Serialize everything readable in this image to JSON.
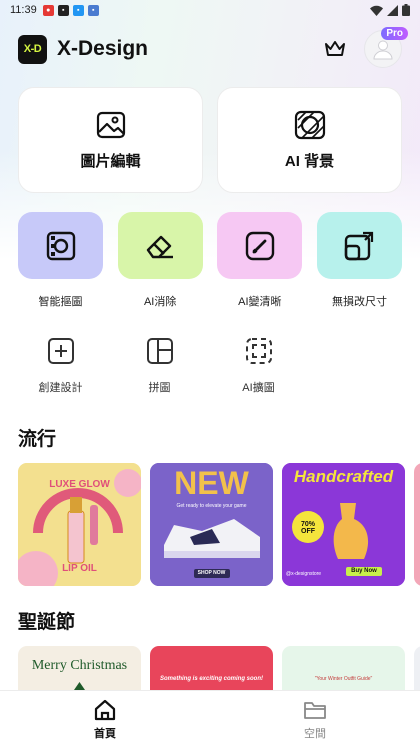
{
  "status_bar": {
    "time": "11:39"
  },
  "header": {
    "logo_text": "X-D",
    "title": "X-Design",
    "pro_badge": "Pro"
  },
  "main_cards": [
    {
      "label": "圖片編輯",
      "icon": "image-icon"
    },
    {
      "label": "AI 背景",
      "icon": "ai-background-icon"
    }
  ],
  "tools": [
    {
      "label": "智能摳圖",
      "icon": "smart-cutout-icon",
      "color": "#c7c9f9"
    },
    {
      "label": "AI消除",
      "icon": "eraser-icon",
      "color": "#d8f5a9"
    },
    {
      "label": "AI變清晰",
      "icon": "enhance-icon",
      "color": "#f6c8f3"
    },
    {
      "label": "無損改尺寸",
      "icon": "resize-icon",
      "color": "#b7f1ec"
    }
  ],
  "tools_secondary": [
    {
      "label": "創建設計",
      "icon": "add-design-icon"
    },
    {
      "label": "拼圖",
      "icon": "collage-icon"
    },
    {
      "label": "AI擴圖",
      "icon": "expand-icon"
    }
  ],
  "sections": {
    "trending": {
      "title": "流行",
      "templates": [
        {
          "line1": "LUXE GLOW",
          "line2": "LIP OIL"
        },
        {
          "line1": "NEW",
          "line2": "Get ready to elevate your game",
          "line3": "SHOP NOW"
        },
        {
          "line1": "Handcrafted",
          "line2": "70% OFF",
          "line3": "Buy Now",
          "line4": "@x-designstore"
        }
      ]
    },
    "christmas": {
      "title": "聖誕節",
      "templates": [
        {
          "line1": "Merry Christmas"
        },
        {
          "line1": "Something is exciting coming soon!"
        },
        {
          "line1": "\"Your Winter Outfit Guide\""
        }
      ]
    }
  },
  "nav": {
    "home_label": "首頁",
    "space_label": "空間"
  },
  "colors": {
    "logo_bg": "#111111",
    "logo_text": "#d5f542",
    "pro_gradient_start": "#7c6bff",
    "pro_gradient_end": "#c05cff"
  }
}
